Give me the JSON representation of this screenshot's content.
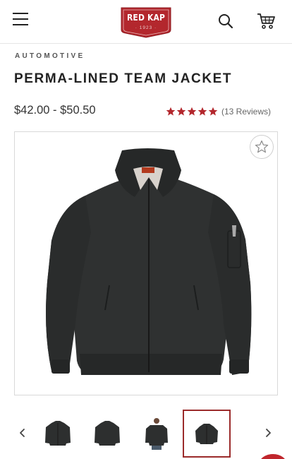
{
  "header": {
    "logo_text": "RED KAP",
    "logo_year": "· 1923 ·",
    "menu_icon": "hamburger-menu-icon",
    "search_icon": "search-icon",
    "cart_icon": "shopping-cart-icon"
  },
  "product": {
    "category": "AUTOMOTIVE",
    "title": "PERMA-LINED TEAM JACKET",
    "price": "$42.00 - $50.50",
    "rating": 5,
    "reviews": "(13 Reviews)"
  },
  "gallery": {
    "wishlist_icon": "star-outline-icon",
    "prev_icon": "chevron-left-icon",
    "next_icon": "chevron-right-icon",
    "thumbnails": [
      "jacket-front-thumb",
      "jacket-back-thumb",
      "jacket-model-thumb",
      "jacket-angle-thumb"
    ],
    "active_thumbnail": 4
  },
  "colors": {
    "brand_red": "#b3272d",
    "star_red": "#b3272d",
    "active_border": "#9b2b2b"
  }
}
